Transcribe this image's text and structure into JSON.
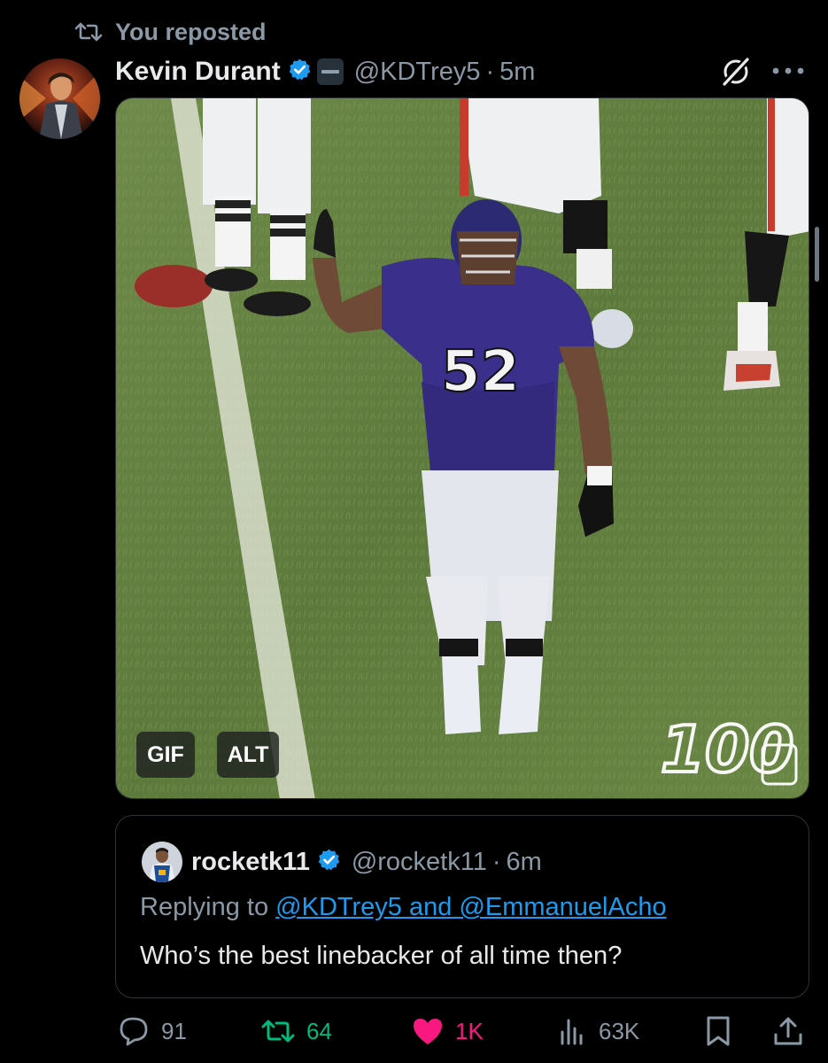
{
  "repost_header": {
    "icon": "repost-icon",
    "text": "You reposted"
  },
  "post": {
    "author_name": "Kevin Durant",
    "verified": true,
    "affiliate_badge": "boardroom-badge",
    "handle": "@KDTrey5",
    "separator": "·",
    "time": "5m",
    "media": {
      "type": "GIF",
      "gif_label": "GIF",
      "alt_label": "ALT",
      "jersey_number": "52"
    }
  },
  "quoted": {
    "author_name": "rocketk11",
    "verified": true,
    "handle": "@rocketk11",
    "separator": "·",
    "time": "6m",
    "replying_prefix": "Replying to ",
    "replying_mentions": "@KDTrey5 and @EmmanuelAcho",
    "text": "Who’s the best linebacker of all time then?"
  },
  "actions": {
    "replies": "91",
    "reposts": "64",
    "likes": "1K",
    "views": "63K"
  },
  "colors": {
    "background": "#000000",
    "secondary_text": "#8b98a5",
    "verified_blue": "#1d9bf0",
    "repost_green": "#00ba7c",
    "like_pink": "#f91880"
  }
}
